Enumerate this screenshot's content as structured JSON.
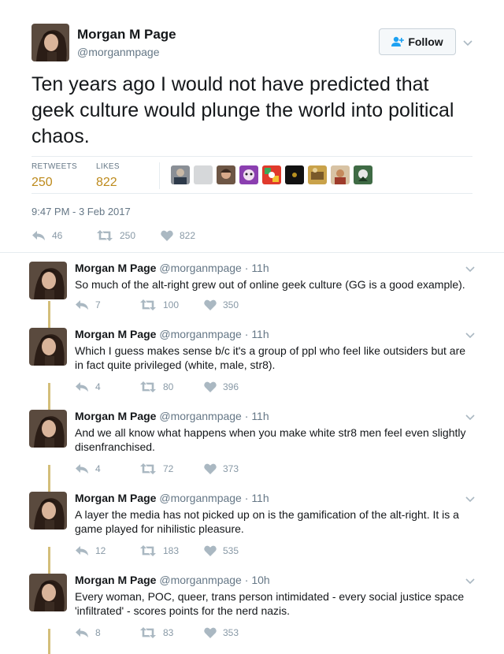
{
  "main_tweet": {
    "name": "Morgan M Page",
    "handle": "@morganmpage",
    "follow_label": "Follow",
    "text": "Ten years ago I would not have predicted that geek culture would plunge the world into political chaos.",
    "retweets_label": "RETWEETS",
    "retweets_value": "250",
    "likes_label": "LIKES",
    "likes_value": "822",
    "timestamp": "9:47 PM - 3 Feb 2017",
    "actions": {
      "replies": "46",
      "retweets": "250",
      "likes": "822"
    }
  },
  "colors": {
    "stat_value": "#bd8a1c",
    "thread_line": "#d4be7a",
    "muted": "#657786",
    "action_icon": "#8899a6"
  },
  "replies": [
    {
      "name": "Morgan M Page",
      "handle": "@morganmpage",
      "time": "11h",
      "text": "So much of the alt-right grew out of online geek culture (GG is a good example).",
      "replies": "7",
      "retweets": "100",
      "likes": "350"
    },
    {
      "name": "Morgan M Page",
      "handle": "@morganmpage",
      "time": "11h",
      "text": "Which I guess makes sense b/c it's a group of ppl who feel like outsiders but are in fact quite privileged (white, male, str8).",
      "replies": "4",
      "retweets": "80",
      "likes": "396"
    },
    {
      "name": "Morgan M Page",
      "handle": "@morganmpage",
      "time": "11h",
      "text": "And we all know what happens when you make white str8 men feel even slightly disenfranchised.",
      "replies": "4",
      "retweets": "72",
      "likes": "373"
    },
    {
      "name": "Morgan M Page",
      "handle": "@morganmpage",
      "time": "11h",
      "text": "A layer the media has not picked up on is the gamification of the alt-right. It is a game played for nihilistic pleasure.",
      "replies": "12",
      "retweets": "183",
      "likes": "535"
    },
    {
      "name": "Morgan M Page",
      "handle": "@morganmpage",
      "time": "10h",
      "text": "Every woman, POC, queer, trans person intimidated - every social justice space 'infiltrated' - scores points for the nerd nazis.",
      "replies": "8",
      "retweets": "83",
      "likes": "353"
    }
  ],
  "icons": {
    "reply": "reply-arrow-icon",
    "retweet": "retweet-icon",
    "like": "heart-icon",
    "caret": "chevron-down-icon",
    "follow": "add-user-icon"
  }
}
